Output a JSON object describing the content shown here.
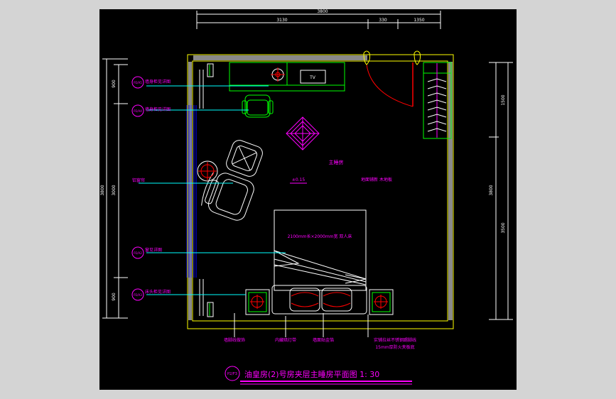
{
  "drawing": {
    "title": "油皇房(2)号房夹层主睡房平面图 1: 30",
    "title_tag": "P2/F3",
    "room_name": "主睡房",
    "floor_note": "地面铺新 木地板",
    "level_mark": "±0.15",
    "bed_note": "2100mm长×2000mm宽 双人床",
    "tv_label": "TV",
    "leader_labels": [
      "墙身柜见详图",
      "墙身柜见详图",
      "铝窗帘",
      "窗见详图",
      "床头柜见详图"
    ],
    "tag_labels": [
      "P2/A5",
      "P2/A4",
      "P2/A2",
      "P2/A3"
    ],
    "bottom_notes": [
      "墙脚线做饰",
      "内藏暗灯带",
      "墙面贴金箔",
      "实铺拉丝不锈钢踢脚线",
      "15mm厚防火夹板底"
    ],
    "dims_top": [
      "3800",
      "3130",
      "330",
      "1350"
    ],
    "dims_left": [
      "900",
      "900",
      "3000",
      "3800",
      "900"
    ],
    "dims_right": [
      "1500",
      "3800",
      "3500"
    ]
  },
  "colors": {
    "background": "#000000",
    "wall": "#ffff00",
    "furniture": "#ffffff",
    "annotation": "#ff00ff",
    "leader": "#00ffff",
    "door": "#ff0000",
    "cabinet": "#00ff00",
    "curtain": "#0000ff"
  }
}
